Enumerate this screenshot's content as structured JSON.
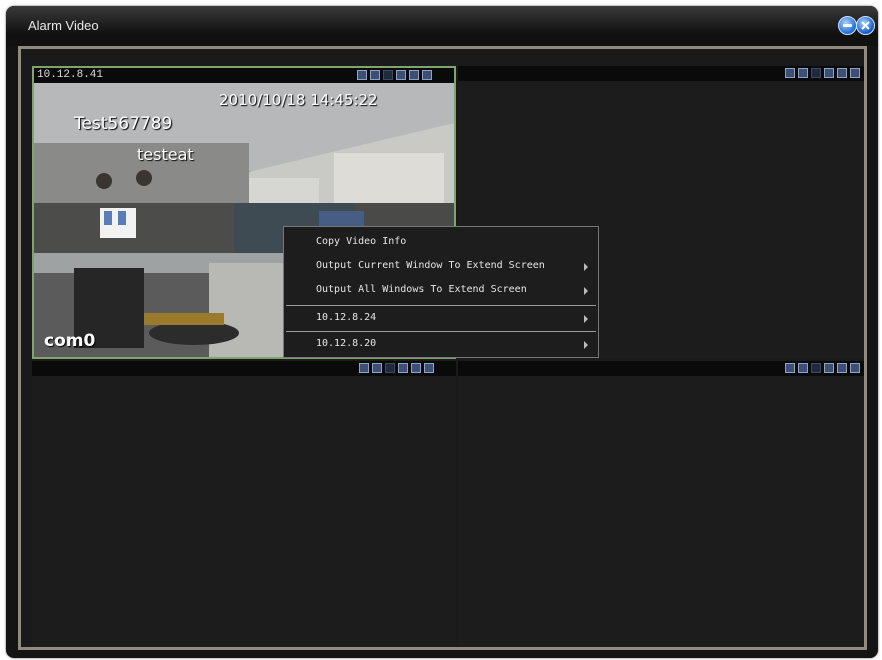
{
  "window": {
    "title": "Alarm Video"
  },
  "panes": [
    {
      "id_label": "10.12.8.41",
      "osd_datetime": "2010/10/18 14:45:22",
      "osd_text1": "Test567789",
      "osd_text2": "testeat",
      "osd_channel": "com0"
    },
    {
      "id_label": ""
    },
    {
      "id_label": ""
    },
    {
      "id_label": ""
    }
  ],
  "pane_tool_icons": [
    "record-icon",
    "snapshot-icon",
    "blank-icon",
    "ptz-icon",
    "audio-icon",
    "close-icon"
  ],
  "context_menu": {
    "items": [
      {
        "label": "Copy Video Info",
        "has_submenu": false
      },
      {
        "label": "Output Current Window To Extend Screen",
        "has_submenu": true
      },
      {
        "label": "Output All Windows To Extend Screen",
        "has_submenu": true
      },
      {
        "label": "10.12.8.24",
        "has_submenu": true
      },
      {
        "label": "10.12.8.20",
        "has_submenu": true
      }
    ]
  },
  "colors": {
    "active_pane_border": "#7fa56c",
    "frame_border": "#8f8c7e",
    "icon_fill": "#3e4f74"
  }
}
